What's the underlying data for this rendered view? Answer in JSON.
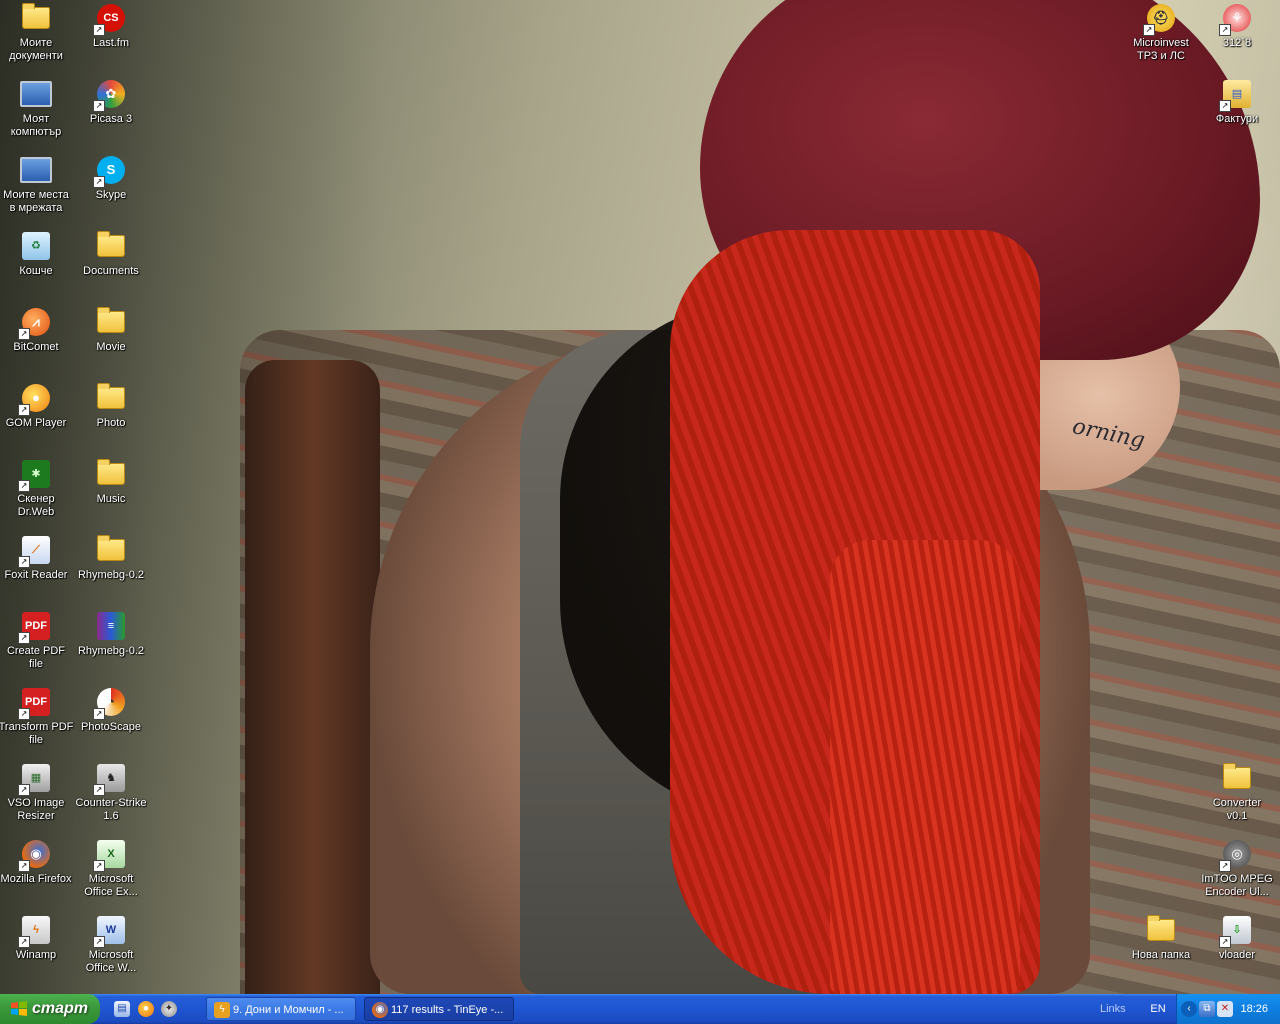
{
  "wallpaper": {
    "tattoo_text": "orning"
  },
  "icons_left_col1": [
    {
      "label": "Моите\nдокументи",
      "icon": "my-documents-icon",
      "shortcut": false
    },
    {
      "label": "Моят\nкомпютър",
      "icon": "my-computer-icon",
      "shortcut": false
    },
    {
      "label": "Моите места\nв мрежата",
      "icon": "network-places-icon",
      "shortcut": false
    },
    {
      "label": "Кошче",
      "icon": "recycle-bin-icon",
      "shortcut": false
    },
    {
      "label": "BitComet",
      "icon": "bitcomet-icon",
      "shortcut": true
    },
    {
      "label": "GOM Player",
      "icon": "gom-player-icon",
      "shortcut": true
    },
    {
      "label": "Скенер\nDr.Web",
      "icon": "drweb-icon",
      "shortcut": true
    },
    {
      "label": "Foxit Reader",
      "icon": "foxit-reader-icon",
      "shortcut": true
    },
    {
      "label": "Create PDF\nfile",
      "icon": "create-pdf-icon",
      "shortcut": true
    },
    {
      "label": "Transform PDF\nfile",
      "icon": "transform-pdf-icon",
      "shortcut": true
    },
    {
      "label": "VSO Image\nResizer",
      "icon": "vso-resizer-icon",
      "shortcut": true
    },
    {
      "label": "Mozilla Firefox",
      "icon": "firefox-icon",
      "shortcut": true
    },
    {
      "label": "Winamp",
      "icon": "winamp-icon",
      "shortcut": true
    }
  ],
  "icons_left_col2": [
    {
      "label": "Last.fm",
      "icon": "lastfm-icon",
      "shortcut": true
    },
    {
      "label": "Picasa 3",
      "icon": "picasa-icon",
      "shortcut": true
    },
    {
      "label": "Skype",
      "icon": "skype-icon",
      "shortcut": true
    },
    {
      "label": "Documents",
      "icon": "folder-icon",
      "shortcut": false
    },
    {
      "label": "Movie",
      "icon": "folder-icon",
      "shortcut": false
    },
    {
      "label": "Photo",
      "icon": "folder-icon",
      "shortcut": false
    },
    {
      "label": "Music",
      "icon": "folder-icon",
      "shortcut": false
    },
    {
      "label": "Rhymebg-0.2",
      "icon": "folder-icon",
      "shortcut": false
    },
    {
      "label": "Rhymebg-0.2",
      "icon": "winrar-archive-icon",
      "shortcut": false
    },
    {
      "label": "PhotoScape",
      "icon": "photoscape-icon",
      "shortcut": true
    },
    {
      "label": "Counter-Strike\n1.6",
      "icon": "counter-strike-icon",
      "shortcut": true
    },
    {
      "label": "Microsoft\nOffice Ex...",
      "icon": "excel-icon",
      "shortcut": true
    },
    {
      "label": "Microsoft\nOffice W...",
      "icon": "word-icon",
      "shortcut": true
    }
  ],
  "icons_right": [
    {
      "label": "Microinvest\nТРЗ и ЛС",
      "icon": "microinvest-icon",
      "shortcut": true
    },
    {
      "label": "312`8",
      "icon": "app-312-icon",
      "shortcut": true
    },
    {
      "label": "Фактури",
      "icon": "invoices-icon",
      "shortcut": true
    },
    {
      "label": "Converter\nv0.1",
      "icon": "folder-icon",
      "shortcut": false
    },
    {
      "label": "ImTOO MPEG\nEncoder Ul...",
      "icon": "imtoo-icon",
      "shortcut": true
    },
    {
      "label": "Нова папка",
      "icon": "folder-icon",
      "shortcut": false
    },
    {
      "label": "vloader",
      "icon": "vloader-icon",
      "shortcut": true
    }
  ],
  "taskbar": {
    "start_label": "старт",
    "quick_launch": [
      "show-desktop-icon",
      "gom-quick-icon",
      "cs-quick-icon"
    ],
    "tasks": [
      {
        "label": "9. Дони и Момчил - ...",
        "icon": "winamp-icon",
        "active": false
      },
      {
        "label": "117 results - TinEye -...",
        "icon": "firefox-icon",
        "active": true
      }
    ],
    "links_label": "Links",
    "language": "EN",
    "clock": "18:26"
  },
  "colors": {
    "taskbar_blue": "#245edb",
    "start_green": "#3c9a3c",
    "tray_blue": "#0e7ee0"
  }
}
